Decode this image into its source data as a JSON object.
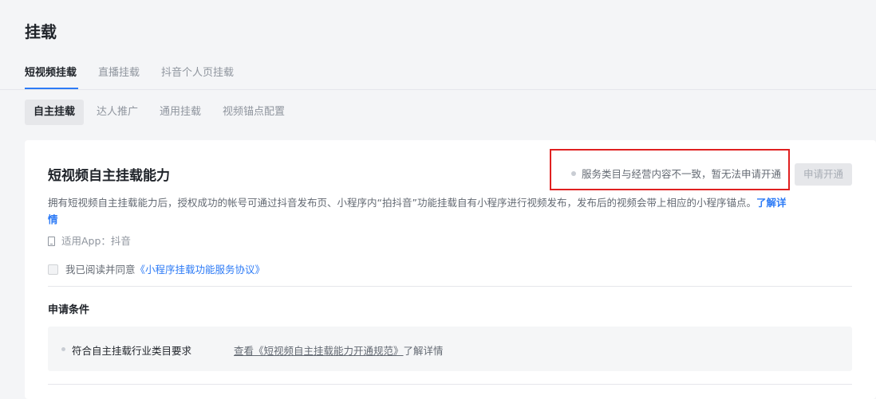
{
  "page": {
    "title": "挂载"
  },
  "tabs_primary": [
    {
      "label": "短视频挂载",
      "active": true
    },
    {
      "label": "直播挂载",
      "active": false
    },
    {
      "label": "抖音个人页挂载",
      "active": false
    }
  ],
  "tabs_secondary": [
    {
      "label": "自主挂载",
      "active": true
    },
    {
      "label": "达人推广",
      "active": false
    },
    {
      "label": "通用挂载",
      "active": false
    },
    {
      "label": "视频锚点配置",
      "active": false
    }
  ],
  "card": {
    "title": "短视频自主挂载能力",
    "status_text": "服务类目与经营内容不一致，暂无法申请开通",
    "apply_button": "申请开通",
    "description": "拥有短视频自主挂载能力后，授权成功的帐号可通过抖音发布页、小程序内“拍抖音”功能挂载自有小程序进行视频发布，发布后的视频会带上相应的小程序锚点。",
    "learn_more": "了解详情",
    "app_label": "适用App：抖音",
    "agree_prefix": "我已阅读并同意",
    "agree_link": "《小程序挂载功能服务协议》"
  },
  "conditions": {
    "title": "申请条件",
    "items": [
      {
        "text": "符合自主挂载行业类目要求",
        "link_prefix": "查看",
        "link_text": "《短视频自主挂载能力开通规范》",
        "link_suffix": "了解详情"
      }
    ]
  },
  "colors": {
    "accent": "#2d7bf6",
    "highlight_border": "#e02020"
  }
}
